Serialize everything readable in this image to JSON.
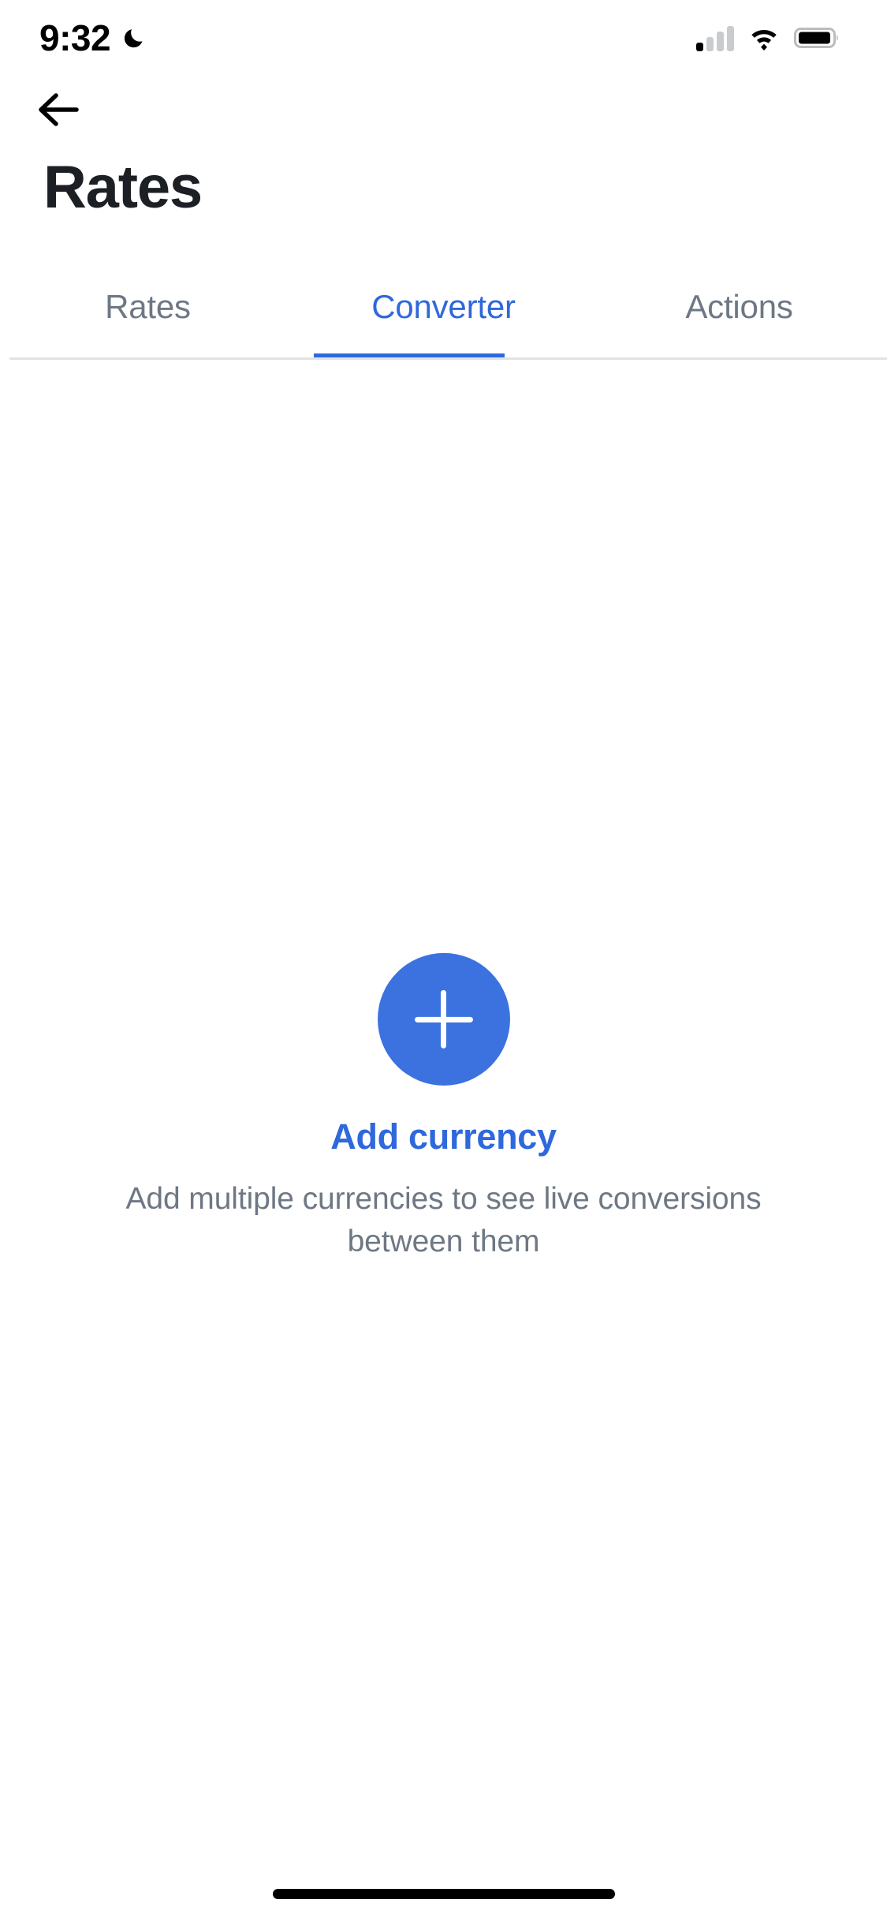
{
  "status_bar": {
    "time": "9:32",
    "dnd_icon": "crescent-moon-icon",
    "signal_icon": "cellular-signal-icon",
    "signal_bars_filled": 1,
    "signal_bars_total": 4,
    "wifi_icon": "wifi-icon",
    "battery_icon": "battery-icon",
    "battery_level_percent": 88
  },
  "nav": {
    "back_icon": "arrow-left-icon"
  },
  "header": {
    "title": "Rates"
  },
  "tabs": {
    "items": [
      {
        "label": "Rates",
        "active": false
      },
      {
        "label": "Converter",
        "active": true
      },
      {
        "label": "Actions",
        "active": false
      }
    ],
    "active_index": 1
  },
  "empty_state": {
    "fab_icon": "plus-icon",
    "action_label": "Add currency",
    "description": "Add multiple currencies to see live conversions between them"
  },
  "colors": {
    "accent_blue": "#2f68dc",
    "fab_blue": "#3b72e0",
    "title_dark": "#1c2024",
    "muted_gray": "#6e7884",
    "divider": "#dfe3e8",
    "background": "#ffffff"
  },
  "home_indicator": {
    "present": true
  }
}
